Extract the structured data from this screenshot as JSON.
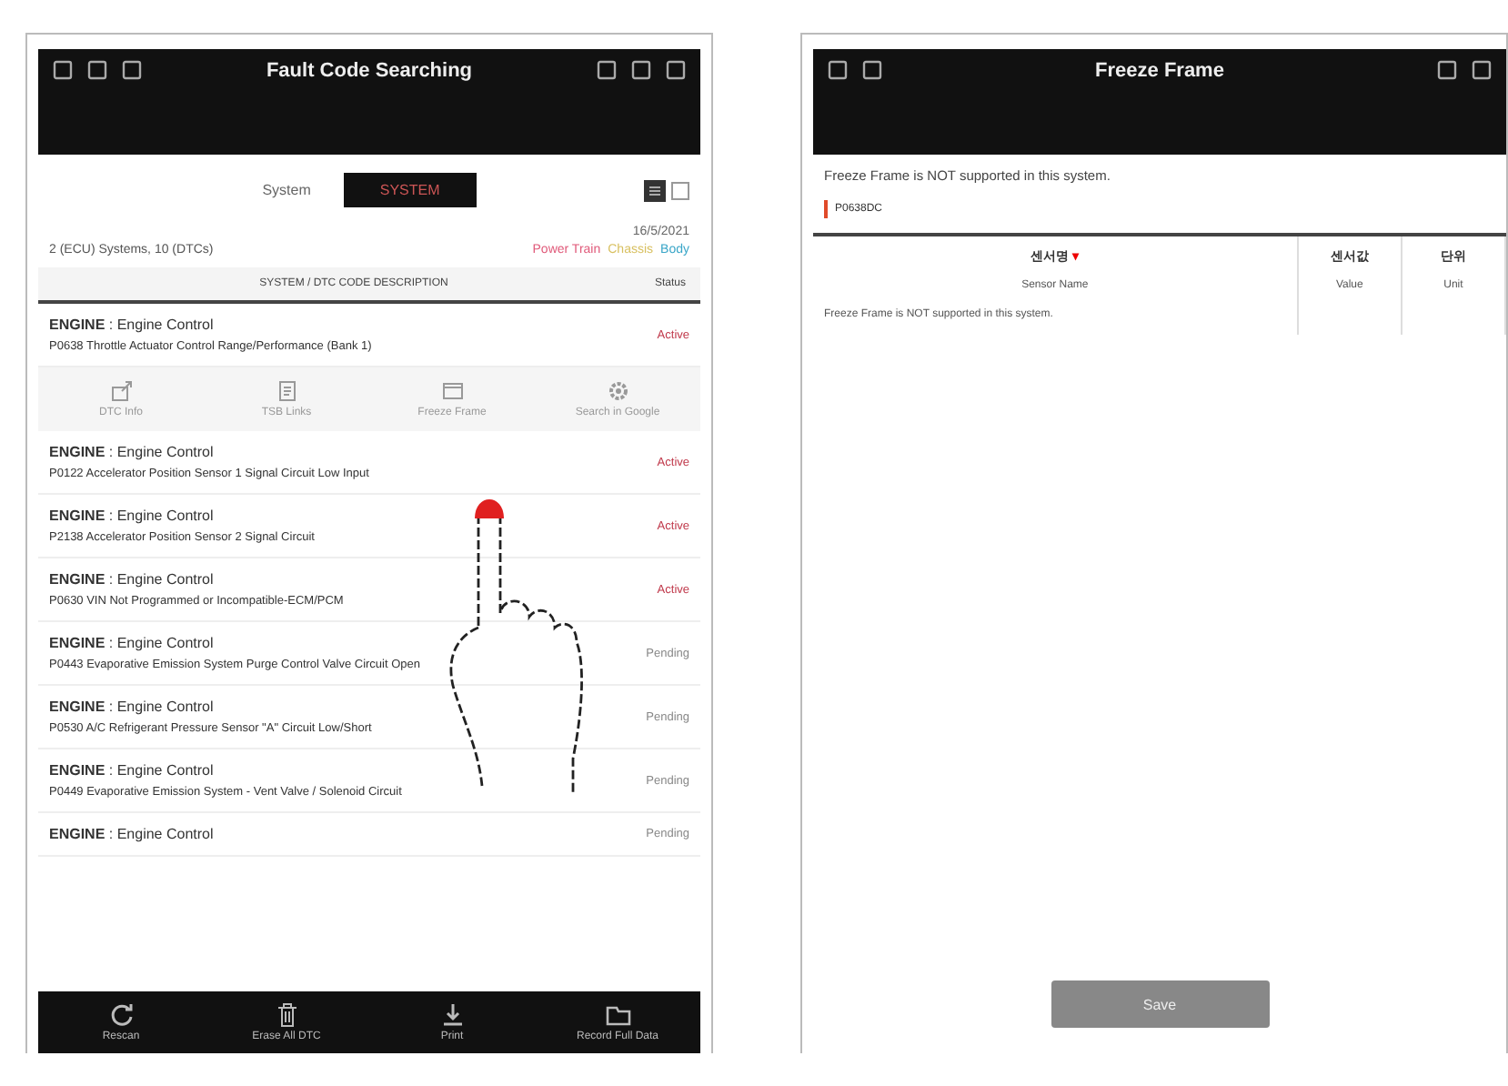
{
  "left_screen": {
    "title": "Fault Code Searching",
    "system_label": "System",
    "system_button": "SYSTEM",
    "date": "16/5/2021",
    "summary": "2 (ECU) Systems, 10 (DTCs)",
    "legend": [
      {
        "label": "Power Train",
        "color": "#e05a7a"
      },
      {
        "label": "Chassis",
        "color": "#d8c060"
      },
      {
        "label": "Body",
        "color": "#3aa6c8"
      }
    ],
    "columns": [
      "SYSTEM / DTC CODE DESCRIPTION",
      "Status"
    ],
    "dtcs": [
      {
        "system": "**ENGINE** : Engine Control",
        "description": "P0638 Throttle Actuator Control Range/Performance (Bank 1)",
        "status": "Active",
        "kind": "active",
        "actions": [
          {
            "label": "DTC Info",
            "kind": "export"
          },
          {
            "label": "TSB Links",
            "kind": "doc"
          },
          {
            "label": "Freeze Frame",
            "kind": "frame"
          },
          {
            "label": "Search in Google",
            "kind": "gear"
          }
        ]
      },
      {
        "system": "**ENGINE** : Engine Control",
        "description": "P0122 Accelerator Position Sensor 1 Signal Circuit Low Input",
        "status": "Active",
        "kind": "active"
      },
      {
        "system": "**ENGINE** : Engine Control",
        "description": "P2138 Accelerator Position Sensor 2 Signal Circuit",
        "status": "Active",
        "kind": "active"
      },
      {
        "system": "**ENGINE** : Engine Control",
        "description": "P0630 VIN Not Programmed or Incompatible-ECM/PCM",
        "status": "Active",
        "kind": "active"
      },
      {
        "system": "**ENGINE** : Engine Control",
        "description": "P0443 Evaporative Emission System Purge Control Valve Circuit Open",
        "status": "Pending",
        "kind": "pending"
      },
      {
        "system": "**ENGINE** : Engine Control",
        "description": "P0530 A/C Refrigerant Pressure Sensor \"A\" Circuit Low/Short",
        "status": "Pending",
        "kind": "pending"
      },
      {
        "system": "**ENGINE** : Engine Control",
        "description": "P0449 Evaporative Emission System - Vent Valve / Solenoid Circuit",
        "status": "Pending",
        "kind": "pending"
      },
      {
        "system": "**ENGINE** : Engine Control",
        "status": "Pending",
        "kind": "pending"
      }
    ],
    "bottom_bar": [
      {
        "label": "Rescan",
        "kind": "refresh"
      },
      {
        "label": "Erase All DTC",
        "kind": "trash"
      },
      {
        "label": "Print",
        "kind": "print"
      },
      {
        "label": "Record Full Data",
        "kind": "record"
      }
    ]
  },
  "right_screen": {
    "title": "Freeze Frame",
    "notice": "Freeze Frame is NOT supported in this system.",
    "code": "P0638DC",
    "columns": [
      "센서명",
      "센서값",
      "단위"
    ],
    "sort_marker": "▾",
    "rows": [
      [
        "Sensor Name",
        "Value",
        "Unit"
      ]
    ],
    "message": "Freeze Frame is NOT supported in this system.",
    "save_button": "Save"
  }
}
